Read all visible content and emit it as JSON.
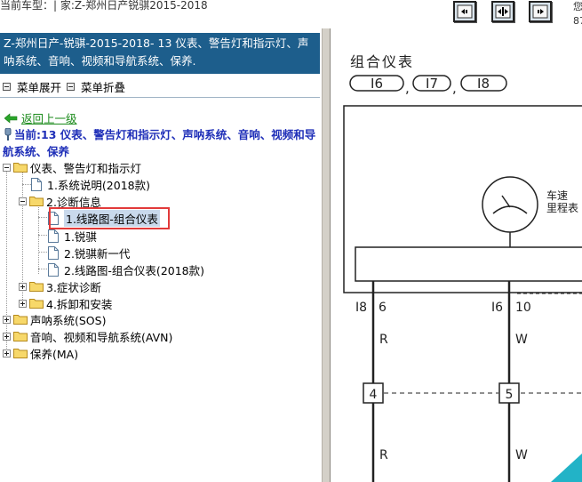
{
  "topbar": {
    "car_model_text": "当前车型：| 家:Z-郑州日产锐骐2015-2018",
    "nav_buttons": [
      "prev-icon",
      "expand-icon",
      "next-icon"
    ],
    "right_text_1": "您",
    "right_text_2": "87"
  },
  "left": {
    "header_title": "Z-郑州日产-锐骐-2015-2018- 13 仪表、警告灯和指示灯、声呐系统、音响、视频和导航系统、保养.",
    "menu_expand": "菜单展开",
    "menu_collapse": "菜单折叠",
    "back_link": "返回上一级",
    "current_label": "当前:13 仪表、警告灯和指示灯、声呐系统、音响、视频和导航系统、保养",
    "tree": {
      "n1": "仪表、警告灯和指示灯",
      "n1_1": "1.系统说明(2018款)",
      "n1_2": "2.诊断信息",
      "n1_2_1": "1.线路图-组合仪表",
      "n1_2_2": "1.锐骐",
      "n1_2_3": "2.锐骐新一代",
      "n1_2_4": "2.线路图-组合仪表(2018款)",
      "n1_3": "3.症状诊断",
      "n1_4": "4.拆卸和安装",
      "n2": "声呐系统(SOS)",
      "n3": "音响、视频和导航系统(AVN)",
      "n4": "保养(MA)"
    }
  },
  "diagram": {
    "title": "组合仪表",
    "connectors": [
      "I6",
      "I7",
      "I8"
    ],
    "sep": ",",
    "gauge_label_1": "车速",
    "gauge_label_2": "里程表",
    "pin_left_conn": "I8",
    "pin_left_num": "6",
    "pin_right_conn": "I6",
    "pin_right_num": "10",
    "wire_left": "R",
    "wire_right": "W",
    "splice_left": "4",
    "splice_right": "5",
    "wire_left_2": "R",
    "wire_right_2": "W"
  },
  "colors": {
    "header_bg": "#1d5e8c",
    "current_text": "#1f2fb8",
    "back_link": "#1a8a1a",
    "selection_box": "#e23a3a",
    "accent_triangle": "#22b3c7"
  }
}
